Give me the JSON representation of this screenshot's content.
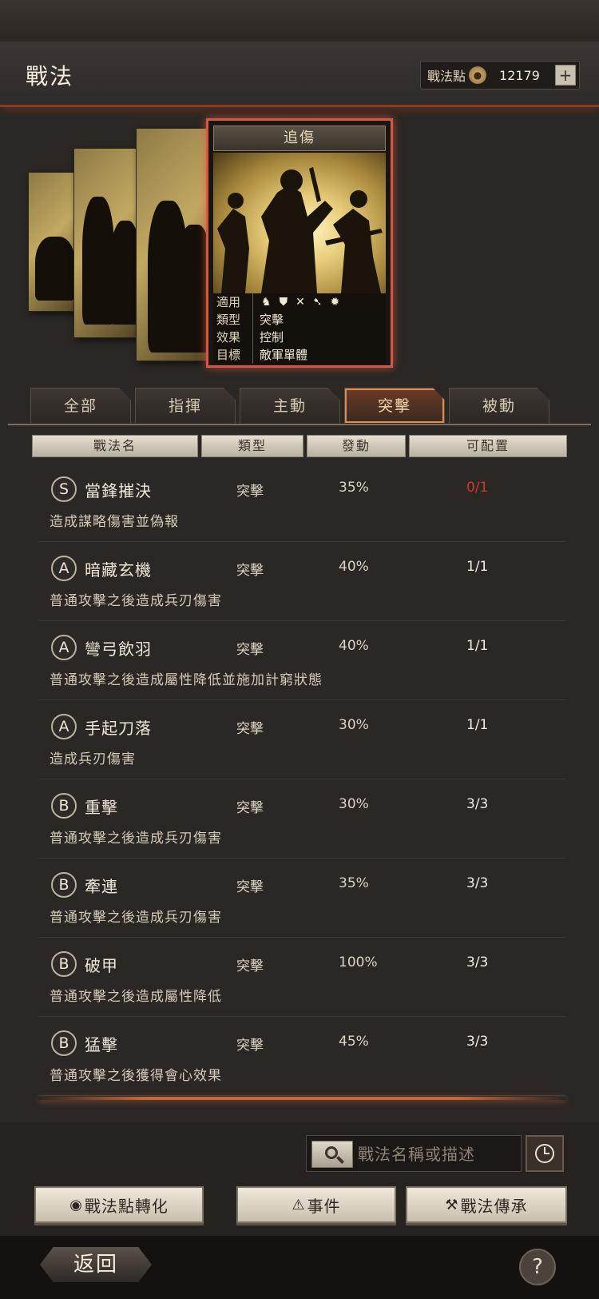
{
  "header": {
    "title": "戰法",
    "points_label": "戰法點",
    "points_value": "12179",
    "plus": "+"
  },
  "card": {
    "title": "追傷",
    "rows": [
      {
        "key": "適用",
        "value": ""
      },
      {
        "key": "類型",
        "value": "突擊"
      },
      {
        "key": "效果",
        "value": "控制"
      },
      {
        "key": "目標",
        "value": "敵軍單體"
      }
    ],
    "weapon_icons": [
      "cavalry-icon",
      "shield-icon",
      "bow-icon",
      "spear-icon",
      "siege-icon"
    ]
  },
  "tabs": [
    {
      "label": "全部",
      "active": false
    },
    {
      "label": "指揮",
      "active": false
    },
    {
      "label": "主動",
      "active": false
    },
    {
      "label": "突擊",
      "active": true
    },
    {
      "label": "被動",
      "active": false
    }
  ],
  "table_headers": [
    "戰法名",
    "類型",
    "發動",
    "可配置"
  ],
  "skills": [
    {
      "grade": "S",
      "name": "當鋒摧決",
      "type": "突擊",
      "rate": "35%",
      "available": "0/1",
      "desc": "造成謀略傷害並偽報"
    },
    {
      "grade": "A",
      "name": "暗藏玄機",
      "type": "突擊",
      "rate": "40%",
      "available": "1/1",
      "desc": "普通攻擊之後造成兵刃傷害"
    },
    {
      "grade": "A",
      "name": "彎弓飲羽",
      "type": "突擊",
      "rate": "40%",
      "available": "1/1",
      "desc": "普通攻擊之後造成屬性降低並施加計窮狀態"
    },
    {
      "grade": "A",
      "name": "手起刀落",
      "type": "突擊",
      "rate": "30%",
      "available": "1/1",
      "desc": "造成兵刃傷害"
    },
    {
      "grade": "B",
      "name": "重擊",
      "type": "突擊",
      "rate": "30%",
      "available": "3/3",
      "desc": "普通攻擊之後造成兵刃傷害"
    },
    {
      "grade": "B",
      "name": "牽連",
      "type": "突擊",
      "rate": "35%",
      "available": "3/3",
      "desc": "普通攻擊之後造成兵刃傷害"
    },
    {
      "grade": "B",
      "name": "破甲",
      "type": "突擊",
      "rate": "100%",
      "available": "3/3",
      "desc": "普通攻擊之後造成屬性降低"
    },
    {
      "grade": "B",
      "name": "猛擊",
      "type": "突擊",
      "rate": "45%",
      "available": "3/3",
      "desc": "普通攻擊之後獲得會心效果"
    }
  ],
  "search": {
    "placeholder": "戰法名稱或描述"
  },
  "actions": {
    "convert": "戰法點轉化",
    "events": "事件",
    "inherit": "戰法傳承"
  },
  "footer": {
    "back": "返回",
    "help": "?"
  },
  "colors": {
    "accent": "#d25a42",
    "unavailable": "#d2382b"
  }
}
